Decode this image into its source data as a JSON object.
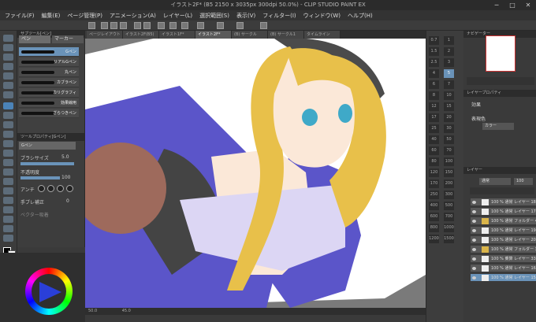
{
  "window": {
    "title": "イラスト2F* (B5 2150 x 3035px 300dpi 50.0%) - CLIP STUDIO PAINT EX",
    "controls": [
      "─",
      "□",
      "✕"
    ]
  },
  "menu": [
    "ファイル(F)",
    "編集(E)",
    "ページ管理(P)",
    "アニメーション(A)",
    "レイヤー(L)",
    "選択範囲(S)",
    "表示(V)",
    "フィルター(I)",
    "ウィンドウ(W)",
    "ヘルプ(H)"
  ],
  "tabs": [
    {
      "label": "ページレイアウト"
    },
    {
      "label": "イラスト2F(B5)"
    },
    {
      "label": "イラスト1F*"
    },
    {
      "label": "イラスト2F*",
      "active": true
    },
    {
      "label": "(B) サークル"
    },
    {
      "label": "(B) サークル1"
    },
    {
      "label": "タイムライン"
    }
  ],
  "subtool": {
    "header": "サブツール[ペン]",
    "tabs": [
      "ペン",
      "マーカー"
    ],
    "brushes": [
      {
        "label": "Gペン",
        "selected": true
      },
      {
        "label": "リアルGペン"
      },
      {
        "label": "丸ペン"
      },
      {
        "label": "カブラペン"
      },
      {
        "label": "カリグラフィ"
      },
      {
        "label": "効果線用"
      },
      {
        "label": "ざらつきペン"
      }
    ]
  },
  "tool_property": {
    "header": "ツールプロパティ[Gペン]",
    "brush_name": "Gペン",
    "brush_size_label": "ブラシサイズ",
    "brush_size_value": "5.0",
    "opacity_label": "不透明度",
    "opacity_value": "100",
    "antialias_label": "アンチ",
    "stabilization_label": "手ブレ補正",
    "stabilization_value": "0",
    "vector_label": "ベクター吸着"
  },
  "canvas": {
    "status_zoom": "50.0",
    "status_angle": "45.0"
  },
  "brush_sizes": [
    "0.7",
    "1",
    "1.5",
    "2",
    "2.5",
    "3",
    "4",
    "5",
    "6",
    "7",
    "8",
    "10",
    "12",
    "15",
    "17",
    "20",
    "25",
    "30",
    "40",
    "50",
    "60",
    "70",
    "80",
    "100",
    "120",
    "150",
    "170",
    "200",
    "250",
    "300",
    "400",
    "500",
    "600",
    "700",
    "800",
    "1000",
    "1200",
    "1500"
  ],
  "navigator": {
    "header": "ナビゲーター"
  },
  "layer_property": {
    "header": "レイヤープロパティ",
    "effect_label": "効果",
    "color_label": "表現色",
    "color_value": "カラー"
  },
  "layers": {
    "header": "レイヤー",
    "blend_mode": "通常",
    "opacity": "100",
    "rows": [
      {
        "label": "100 % 通常 レイヤー 18"
      },
      {
        "label": "100 % 通常 レイヤー 17"
      },
      {
        "label": "100 % 通常 フォルダー 4"
      },
      {
        "label": "100 % 通常 レイヤー 19"
      },
      {
        "label": "100 % 通常 レイヤー 20"
      },
      {
        "label": "100 % 通常 フォルダー 3"
      },
      {
        "label": "100 % 乗算 レイヤー 33"
      },
      {
        "label": "100 % 通常 レイヤー 16"
      },
      {
        "label": "100 % 通常 レイヤー 15",
        "selected": true
      }
    ]
  },
  "colors": {
    "accent": "#4b83b8",
    "hoodie": "#5b55c9",
    "hair": "#e8c04a",
    "skin": "#fbe8d8",
    "top": "#dcd6f4",
    "ball": "#9e6a5c"
  }
}
